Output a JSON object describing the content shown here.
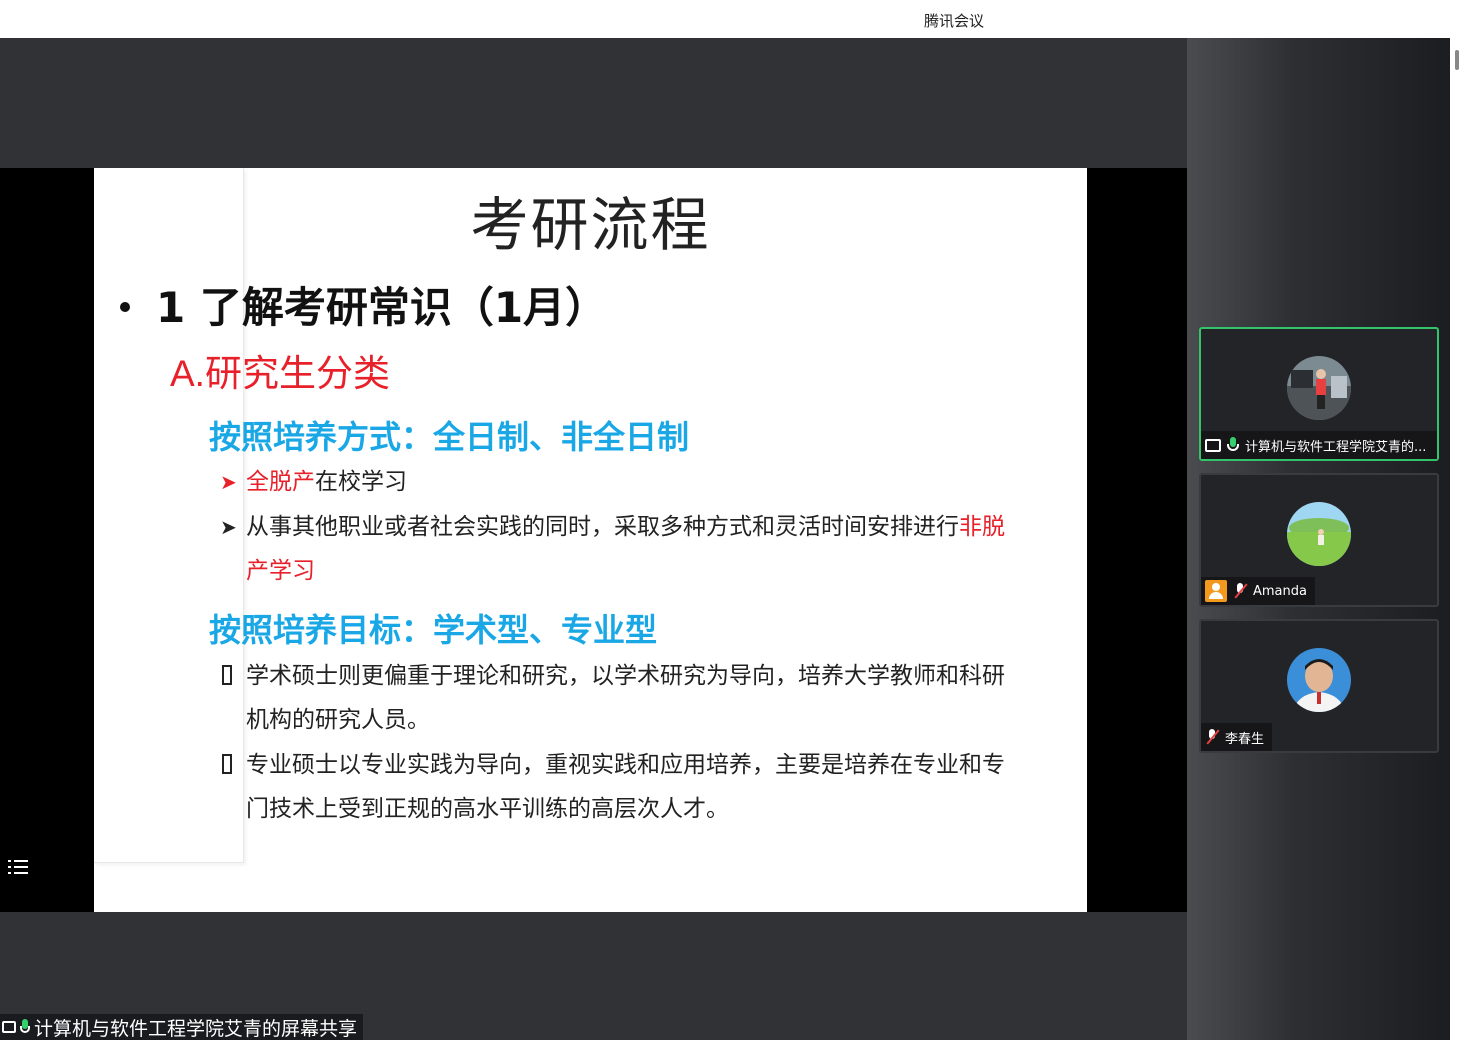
{
  "app": {
    "title": "腾讯会议"
  },
  "slide": {
    "title": "考研流程",
    "bullet": "1 了解考研常识（1月）",
    "section_a_letter": "A.",
    "section_a_text": "研究生分类",
    "heading1": "按照培养方式：全日制、非全日制",
    "item1_red": "全脱产",
    "item1_rest": "在校学习",
    "item2_start": "从事其他职业或者社会实践的同时，采取多种方式和灵活时间安排进行",
    "item2_red_1": "非脱",
    "item2_red_2": "产学习",
    "heading2": "按照培养目标：学术型、专业型",
    "item3_line1": "学术硕士则更偏重于理论和研究，以学术研究为导向，培养大学教师和科研",
    "item3_line2": "机构的研究人员。",
    "item4_line1": "专业硕士以专业实践为导向，重视实践和应用培养，主要是培养在专业和专",
    "item4_line2": "门技术上受到正规的高水平训练的高层次人才。"
  },
  "share_bar": {
    "label": "计算机与软件工程学院艾青的屏幕共享"
  },
  "participants": [
    {
      "name": "计算机与软件工程学院艾青的...",
      "mic": "on",
      "sharing": true
    },
    {
      "name": "Amanda",
      "mic": "muted"
    },
    {
      "name": "李春生",
      "mic": "muted"
    }
  ],
  "colors": {
    "accent_red": "#e8202a",
    "accent_blue": "#1aa7e6",
    "active_border": "#33c36b"
  }
}
